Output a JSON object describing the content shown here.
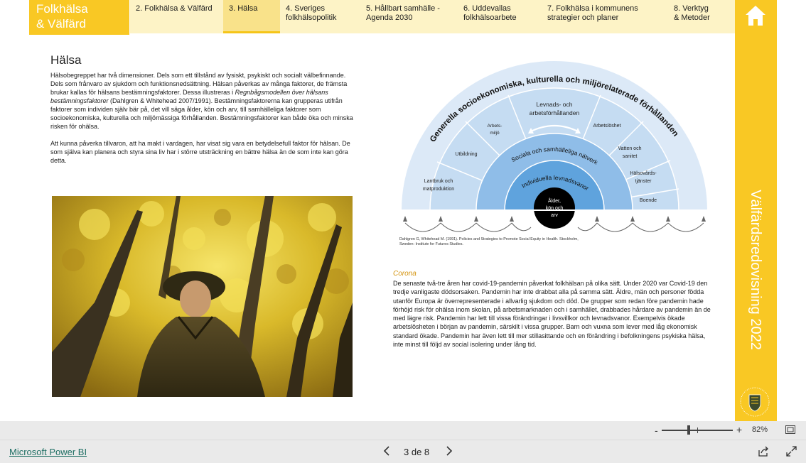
{
  "nav": {
    "brand_line1": "Folkhälsa",
    "brand_line2": "& Välfärd",
    "tabs": [
      {
        "line1": "2. Folkhälsa & Välfärd",
        "line2": ""
      },
      {
        "line1": "3. Hälsa",
        "line2": ""
      },
      {
        "line1": "4. Sveriges",
        "line2": "folkhälsopolitik"
      },
      {
        "line1": "5. Hållbart samhälle -",
        "line2": "Agenda 2030"
      },
      {
        "line1": "6. Uddevallas",
        "line2": "folkhälsoarbete"
      },
      {
        "line1": "7. Folkhälsa i kommunens",
        "line2": "strategier och planer"
      },
      {
        "line1": "8. Verktyg",
        "line2": "& Metoder"
      }
    ],
    "active_tab": "3. Hälsa",
    "home_icon": "home-icon"
  },
  "side": {
    "vertical_title": "Välfärdsredovisning 2022",
    "crest_text": "UDDEVALLA KOMMUN"
  },
  "content": {
    "title": "Hälsa",
    "intro_p1_a": "Hälsobegreppet har två dimensioner. Dels som ett tillstånd av fysiskt, psykiskt och socialt välbefinnande. Dels som frånvaro av sjukdom och funktionsnedsättning. Hälsan påverkas av många faktorer, de främsta brukar kallas för hälsans bestämningsfaktorer. Dessa illustreras i ",
    "intro_p1_em": "Regnbågsmodellen över hälsans bestämningsfaktorer",
    "intro_p1_b": " (Dahlgren & Whitehead 2007/1991). Bestämningsfaktorerna kan grupperas utifrån faktorer som individen själv bär på, det vill säga ålder, kön och arv, till samhälleliga faktorer som socioekonomiska, kulturella och miljömässiga förhållanden. Bestämningsfaktorer kan både öka och minska risken för ohälsa.",
    "intro_p2": "Att kunna påverka tillvaron, att ha makt i vardagen, har visat sig vara en betydelsefull faktor för hälsan. De som själva kan planera och styra sina liv har i större utsträckning en bättre hälsa än de som inte kan göra detta.",
    "corona_heading": "Corona",
    "corona_text": "De senaste två-tre åren har covid-19-pandemin påverkat folkhälsan på olika sätt. Under 2020 var Covid-19 den tredje vanligaste dödsorsaken. Pandemin har inte drabbat alla på samma sätt. Äldre, män och personer födda utanför Europa är överrepresenterade i allvarlig sjukdom och död. De grupper som redan före pandemin hade förhöjd risk för ohälsa inom skolan, på arbetsmarknaden och i samhället, drabbades hårdare av pandemin än de med lägre risk. Pandemin har lett till vissa förändringar i livsvillkor och levnadsvanor. Exempelvis ökade arbetslösheten i början av pandemin, särskilt i vissa grupper. Barn och vuxna som lever med låg ekonomisk standard ökade. Pandemin har även lett till mer stillasittande och en förändring i befolkningens psykiska hälsa, inte minst till följd av social isolering under lång tid."
  },
  "diagram": {
    "outer_label": "Generella socioekonomiska, kulturella och miljörelaterade förhållanden",
    "top_label_1": "Levnads- och",
    "top_label_2": "arbetsförhållanden",
    "sectors": [
      {
        "line1": "Lantbruk och",
        "line2": "matproduktion"
      },
      {
        "line1": "Utbildning",
        "line2": ""
      },
      {
        "line1": "Arbets-",
        "line2": "miljö"
      },
      {
        "line1": "Arbetslöshet",
        "line2": ""
      },
      {
        "line1": "Vatten och",
        "line2": "sanitet"
      },
      {
        "line1": "Hälsovårds-",
        "line2": "tjänster"
      },
      {
        "line1": "Boende",
        "line2": ""
      }
    ],
    "ring_social": "Sociala och samhälleliga nätverk",
    "ring_individ": "Individuella levnadsvanor",
    "core_1": "Ålder,",
    "core_2": "kön och",
    "core_3": "arv",
    "credit": "Dahlgren G, Whitehead M. (1991). Policies and Strategies to Promote Social Equity in Health. Stockholm, Sweden: Institute for Futures Studies.",
    "colors": {
      "outer": "#dce9f7",
      "sectors": "#c5dcf2",
      "social": "#8fbde8",
      "individ": "#5fa3dd",
      "core": "#000000"
    }
  },
  "toolbar": {
    "zoom_minus": "-",
    "zoom_plus": "+",
    "zoom_value": "82%",
    "zoom_level": 0.82
  },
  "footer": {
    "app_link": "Microsoft Power BI",
    "page_indicator": "3 de 8",
    "current_page": 3,
    "total_pages": 8
  },
  "colors": {
    "accent": "#f9c824",
    "tab_bg": "#fdf3c6",
    "corona": "#d4940f"
  }
}
